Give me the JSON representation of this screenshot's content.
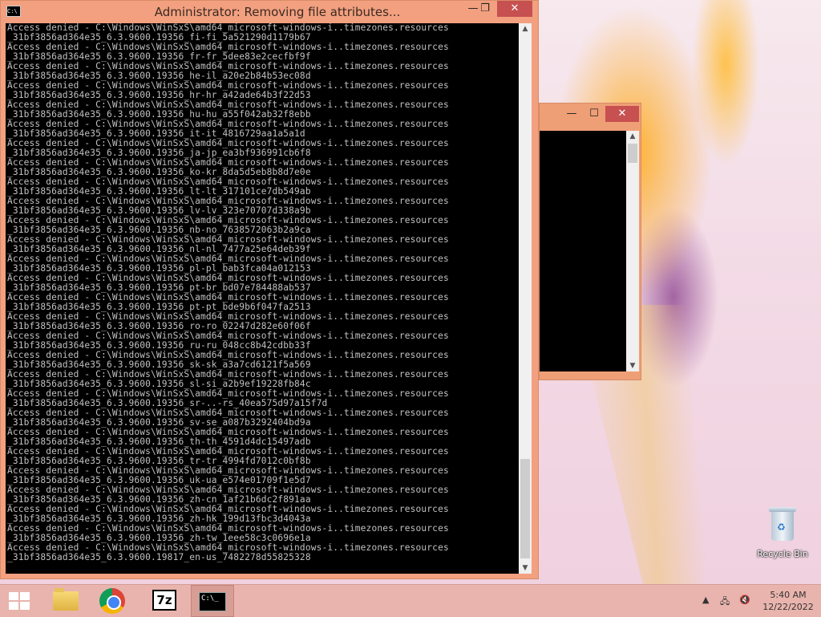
{
  "desktop": {
    "recycle_bin_label": "Recycle Bin"
  },
  "background_window": {
    "minimize_glyph": "—",
    "maximize_glyph": "☐",
    "close_glyph": "✕"
  },
  "console": {
    "title": "Administrator:  Removing file attributes...",
    "icon_text": "C:\\",
    "minimize_glyph": "—",
    "maximize_glyph": "❐",
    "close_glyph": "✕",
    "lines": [
      "Access denied - C:\\Windows\\WinSxS\\amd64_microsoft-windows-i..timezones.resources",
      "_31bf3856ad364e35_6.3.9600.19356_fi-fi_5a521290d1179b67",
      "Access denied - C:\\Windows\\WinSxS\\amd64_microsoft-windows-i..timezones.resources",
      "_31bf3856ad364e35_6.3.9600.19356_fr-fr_5dee83e2cecfbf9f",
      "Access denied - C:\\Windows\\WinSxS\\amd64_microsoft-windows-i..timezones.resources",
      "_31bf3856ad364e35_6.3.9600.19356_he-il_a20e2b84b53ec08d",
      "Access denied - C:\\Windows\\WinSxS\\amd64_microsoft-windows-i..timezones.resources",
      "_31bf3856ad364e35_6.3.9600.19356_hr-hr_a42ade64b3f22d53",
      "Access denied - C:\\Windows\\WinSxS\\amd64_microsoft-windows-i..timezones.resources",
      "_31bf3856ad364e35_6.3.9600.19356_hu-hu_a55f042ab32f8ebb",
      "Access denied - C:\\Windows\\WinSxS\\amd64_microsoft-windows-i..timezones.resources",
      "_31bf3856ad364e35_6.3.9600.19356_it-it_4816729aa1a5a1d",
      "Access denied - C:\\Windows\\WinSxS\\amd64_microsoft-windows-i..timezones.resources",
      "_31bf3856ad364e35_6.3.9600.19356_ja-jp_ea3bf936991cb6f8",
      "Access denied - C:\\Windows\\WinSxS\\amd64_microsoft-windows-i..timezones.resources",
      "_31bf3856ad364e35_6.3.9600.19356_ko-kr_8da5d5eb8b8d7e0e",
      "Access denied - C:\\Windows\\WinSxS\\amd64_microsoft-windows-i..timezones.resources",
      "_31bf3856ad364e35_6.3.9600.19356_lt-lt_317101ce7db549ab",
      "Access denied - C:\\Windows\\WinSxS\\amd64_microsoft-windows-i..timezones.resources",
      "_31bf3856ad364e35_6.3.9600.19356_lv-lv_323e70707d338a9b",
      "Access denied - C:\\Windows\\WinSxS\\amd64_microsoft-windows-i..timezones.resources",
      "_31bf3856ad364e35_6.3.9600.19356_nb-no_7638572063b2a9ca",
      "Access denied - C:\\Windows\\WinSxS\\amd64_microsoft-windows-i..timezones.resources",
      "_31bf3856ad364e35_6.3.9600.19356_nl-nl_7477a25e64deb39f",
      "Access denied - C:\\Windows\\WinSxS\\amd64_microsoft-windows-i..timezones.resources",
      "_31bf3856ad364e35_6.3.9600.19356_pl-pl_bab3fca04a012153",
      "Access denied - C:\\Windows\\WinSxS\\amd64_microsoft-windows-i..timezones.resources",
      "_31bf3856ad364e35_6.3.9600.19356_pt-br_bd07e784488ab537",
      "Access denied - C:\\Windows\\WinSxS\\amd64_microsoft-windows-i..timezones.resources",
      "_31bf3856ad364e35_6.3.9600.19356_pt-pt_bde9b6f047fa2513",
      "Access denied - C:\\Windows\\WinSxS\\amd64_microsoft-windows-i..timezones.resources",
      "_31bf3856ad364e35_6.3.9600.19356_ro-ro_02247d282e60f06f",
      "Access denied - C:\\Windows\\WinSxS\\amd64_microsoft-windows-i..timezones.resources",
      "_31bf3856ad364e35_6.3.9600.19356_ru-ru_048cc8b42cdbb33f",
      "Access denied - C:\\Windows\\WinSxS\\amd64_microsoft-windows-i..timezones.resources",
      "_31bf3856ad364e35_6.3.9600.19356_sk-sk_a3a7cd6121f5a569",
      "Access denied - C:\\Windows\\WinSxS\\amd64_microsoft-windows-i..timezones.resources",
      "_31bf3856ad364e35_6.3.9600.19356_sl-si_a2b9ef19228fb84c",
      "Access denied - C:\\Windows\\WinSxS\\amd64_microsoft-windows-i..timezones.resources",
      "_31bf3856ad364e35_6.3.9600.19356_sr-..-rs_40ea575d97a15f7d",
      "Access denied - C:\\Windows\\WinSxS\\amd64_microsoft-windows-i..timezones.resources",
      "_31bf3856ad364e35_6.3.9600.19356_sv-se_a087b3292404bd9a",
      "Access denied - C:\\Windows\\WinSxS\\amd64_microsoft-windows-i..timezones.resources",
      "_31bf3856ad364e35_6.3.9600.19356_th-th_4591d4dc15497adb",
      "Access denied - C:\\Windows\\WinSxS\\amd64_microsoft-windows-i..timezones.resources",
      "_31bf3856ad364e35_6.3.9600.19356_tr-tr_4994fd7012c0bf8b",
      "Access denied - C:\\Windows\\WinSxS\\amd64_microsoft-windows-i..timezones.resources",
      "_31bf3856ad364e35_6.3.9600.19356_uk-ua_e574e01709f1e5d7",
      "Access denied - C:\\Windows\\WinSxS\\amd64_microsoft-windows-i..timezones.resources",
      "_31bf3856ad364e35_6.3.9600.19356_zh-cn_1af21b6dc2f891aa",
      "Access denied - C:\\Windows\\WinSxS\\amd64_microsoft-windows-i..timezones.resources",
      "_31bf3856ad364e35_6.3.9600.19356_zh-hk_199d13fbc3d4043a",
      "Access denied - C:\\Windows\\WinSxS\\amd64_microsoft-windows-i..timezones.resources",
      "_31bf3856ad364e35_6.3.9600.19356_zh-tw_1eee58c3c0696e1a",
      "Access denied - C:\\Windows\\WinSxS\\amd64_microsoft-windows-i..timezones.resources",
      "_31bf3856ad364e35_6.3.9600.19817_en-us_7482278d55825328"
    ]
  },
  "taskbar": {
    "sevenzip_label": "7z",
    "cmd_icon_text": "C:\\_",
    "tray": {
      "arrow_glyph": "▲",
      "network_glyph": "🖧",
      "volume_glyph": "🔇"
    },
    "clock": {
      "time": "5:40 AM",
      "date": "12/22/2022"
    }
  },
  "colors": {
    "console_frame": "#f2a07f",
    "close_button": "#c75050",
    "console_text": "#c0c0c0",
    "taskbar": "#e9b4ad"
  }
}
